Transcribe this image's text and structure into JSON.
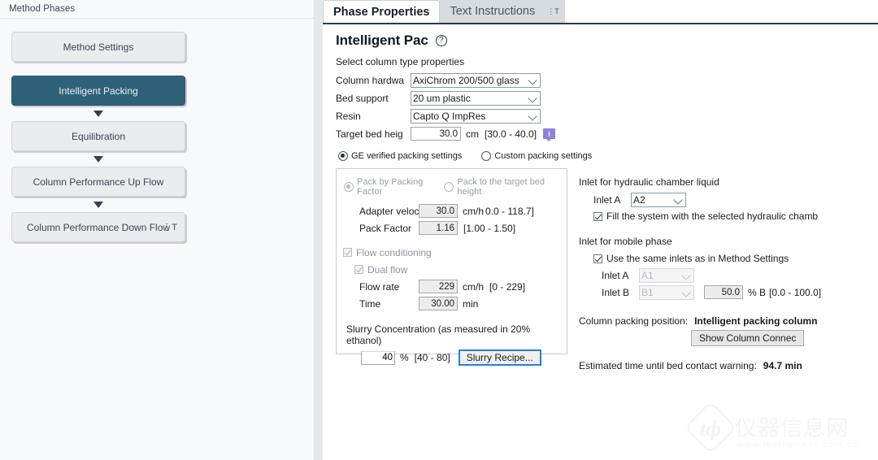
{
  "left_panel": {
    "header_title": "Method Phases",
    "phases": [
      {
        "label": "Method Settings",
        "selected": false,
        "has_menu": false
      },
      {
        "label": "Intelligent Packing",
        "selected": true,
        "has_menu": false
      },
      {
        "label": "Equilibration",
        "selected": false,
        "has_menu": false
      },
      {
        "label": "Column Performance Up Flow",
        "selected": false,
        "has_menu": false
      },
      {
        "label": "Column Performance Down Flow",
        "selected": false,
        "has_menu": true,
        "menu_glyph": "T"
      }
    ]
  },
  "tabs": {
    "active": "Phase Properties",
    "inactive": "Text Instructions",
    "pin_glyph": "⋮T"
  },
  "page": {
    "title": "Intelligent Pac",
    "help_glyph": "?"
  },
  "column_type": {
    "section_label": "Select column type properties",
    "fields": [
      {
        "label": "Column hardwa",
        "value": "AxiChrom 200/500 glass"
      },
      {
        "label": "Bed support",
        "value": "20 um plastic"
      },
      {
        "label": "Resin",
        "value": "Capto Q ImpRes"
      }
    ],
    "target_bed_height": {
      "label": "Target bed heig",
      "value": "30.0",
      "unit": "cm",
      "range": "[30.0 - 40.0]",
      "info_glyph": "i"
    }
  },
  "settings_mode": {
    "ge_verified": "GE verified packing settings",
    "custom": "Custom packing settings",
    "selected": "GE verified packing settings"
  },
  "groupbox": {
    "pack_mode": {
      "by_factor": "Pack by Packing Factor",
      "to_height": "Pack to the target bed height",
      "selected": "Pack by Packing Factor"
    },
    "adapter_velocity": {
      "label": "Adapter veloc",
      "value": "30.0",
      "unit": "cm/h",
      "range": "0.0 - 118.7]"
    },
    "pack_factor": {
      "label": "Pack Factor",
      "value": "1.16",
      "range": "[1.00 - 1.50]"
    },
    "flow_conditioning": {
      "label": "Flow conditioning",
      "checked": true,
      "enabled": false
    },
    "dual_flow": {
      "label": "Dual flow",
      "checked": true,
      "enabled": false
    },
    "flow_rate": {
      "label": "Flow rate",
      "value": "229",
      "unit": "cm/h",
      "range": "[0 - 229]"
    },
    "time": {
      "label": "Time",
      "value": "30.00",
      "unit": "min"
    },
    "slurry": {
      "title": "Slurry Concentration (as measured in 20% ethanol)",
      "value": "40",
      "unit": "%",
      "range": "[40 - 80]",
      "recipe_button": "Slurry Recipe..."
    }
  },
  "inlets": {
    "hydraulic": {
      "title": "Inlet for hydraulic chamber liquid",
      "inlet_a_label": "Inlet A",
      "inlet_a_value": "A2",
      "fill_checkbox": "Fill the system with the selected hydraulic chamb",
      "fill_checked": true
    },
    "mobile_phase": {
      "title": "Inlet for mobile phase",
      "same_inlets_label": "Use the same inlets as in Method Settings",
      "same_inlets_checked": true,
      "inlet_a_label": "Inlet A",
      "inlet_a_value": "A1",
      "inlet_b_label": "Inlet B",
      "inlet_b_value": "B1",
      "percent_b_value": "50.0",
      "percent_b_unit": "% B",
      "percent_b_range": "[0.0 - 100.0]"
    }
  },
  "summary": {
    "packing_position_label": "Column packing position:",
    "packing_position_value": "Intelligent packing column",
    "show_connections_button": "Show Column Connec",
    "estimated_time_label": "Estimated time until bed contact warning:",
    "estimated_time_value": "94.7 min"
  },
  "watermark": {
    "text": "仪器信息网",
    "url": "www.instrument.com.cn"
  }
}
